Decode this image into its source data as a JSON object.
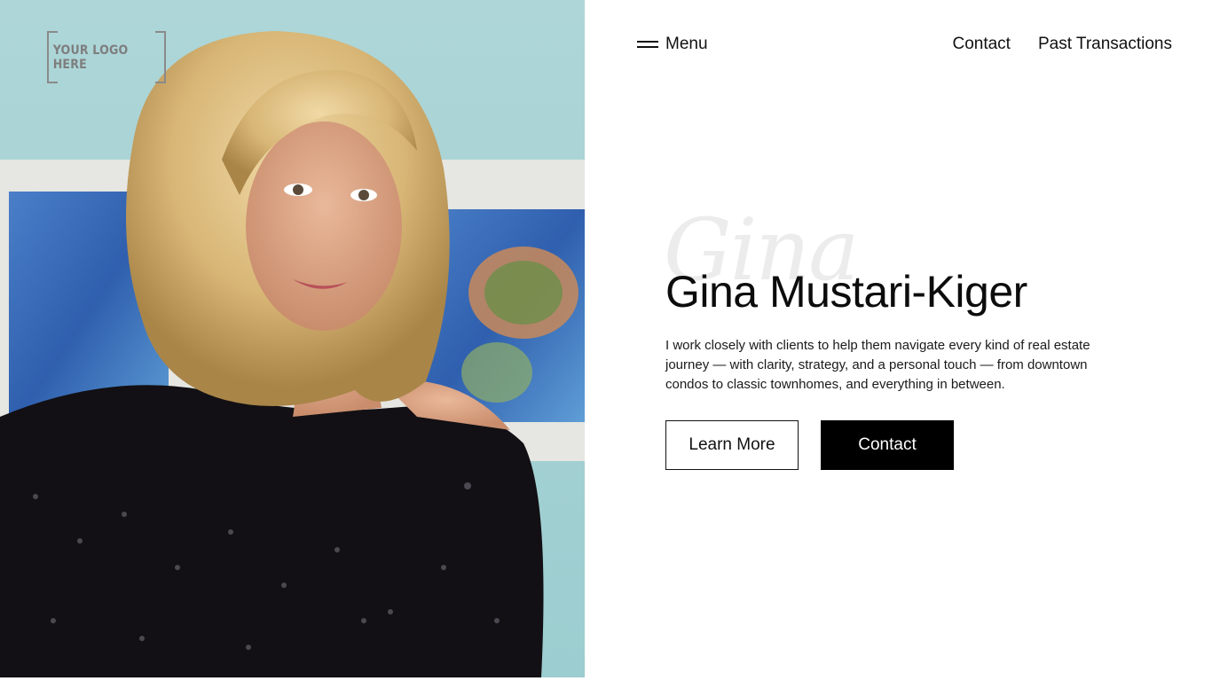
{
  "brand": {
    "logo_text": "YOUR LOGO HERE"
  },
  "nav": {
    "menu_label": "Menu",
    "links": [
      "Contact",
      "Past Transactions"
    ]
  },
  "hero": {
    "script_word": "Gina",
    "name": "Gina Mustari-Kiger",
    "intro": "I work closely with clients to help them navigate every kind of real estate journey — with clarity, strategy, and a personal touch — from downtown condos to classic townhomes, and everything in between.",
    "primary_button": "Learn More",
    "secondary_button": "Contact"
  },
  "colors": {
    "wall": "#a9d3d6",
    "accent_button": "#000000",
    "text": "#111111"
  }
}
